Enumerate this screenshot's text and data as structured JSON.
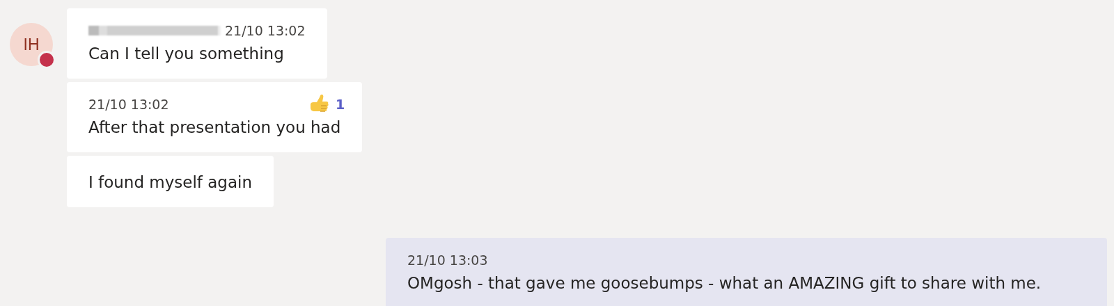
{
  "incoming": {
    "avatar": {
      "initials": "IH",
      "busy": true
    },
    "messages": [
      {
        "sender_hidden": true,
        "time": "21/10 13:02",
        "text": "Can I tell you something"
      },
      {
        "time": "21/10 13:02",
        "text": "After that presentation you had",
        "reaction": {
          "count": "1"
        }
      },
      {
        "text": "I found myself again"
      }
    ]
  },
  "outgoing": {
    "messages": [
      {
        "time": "21/10 13:03",
        "text": "OMgosh - that gave me goosebumps - what an AMAZING gift to share with me."
      }
    ]
  }
}
